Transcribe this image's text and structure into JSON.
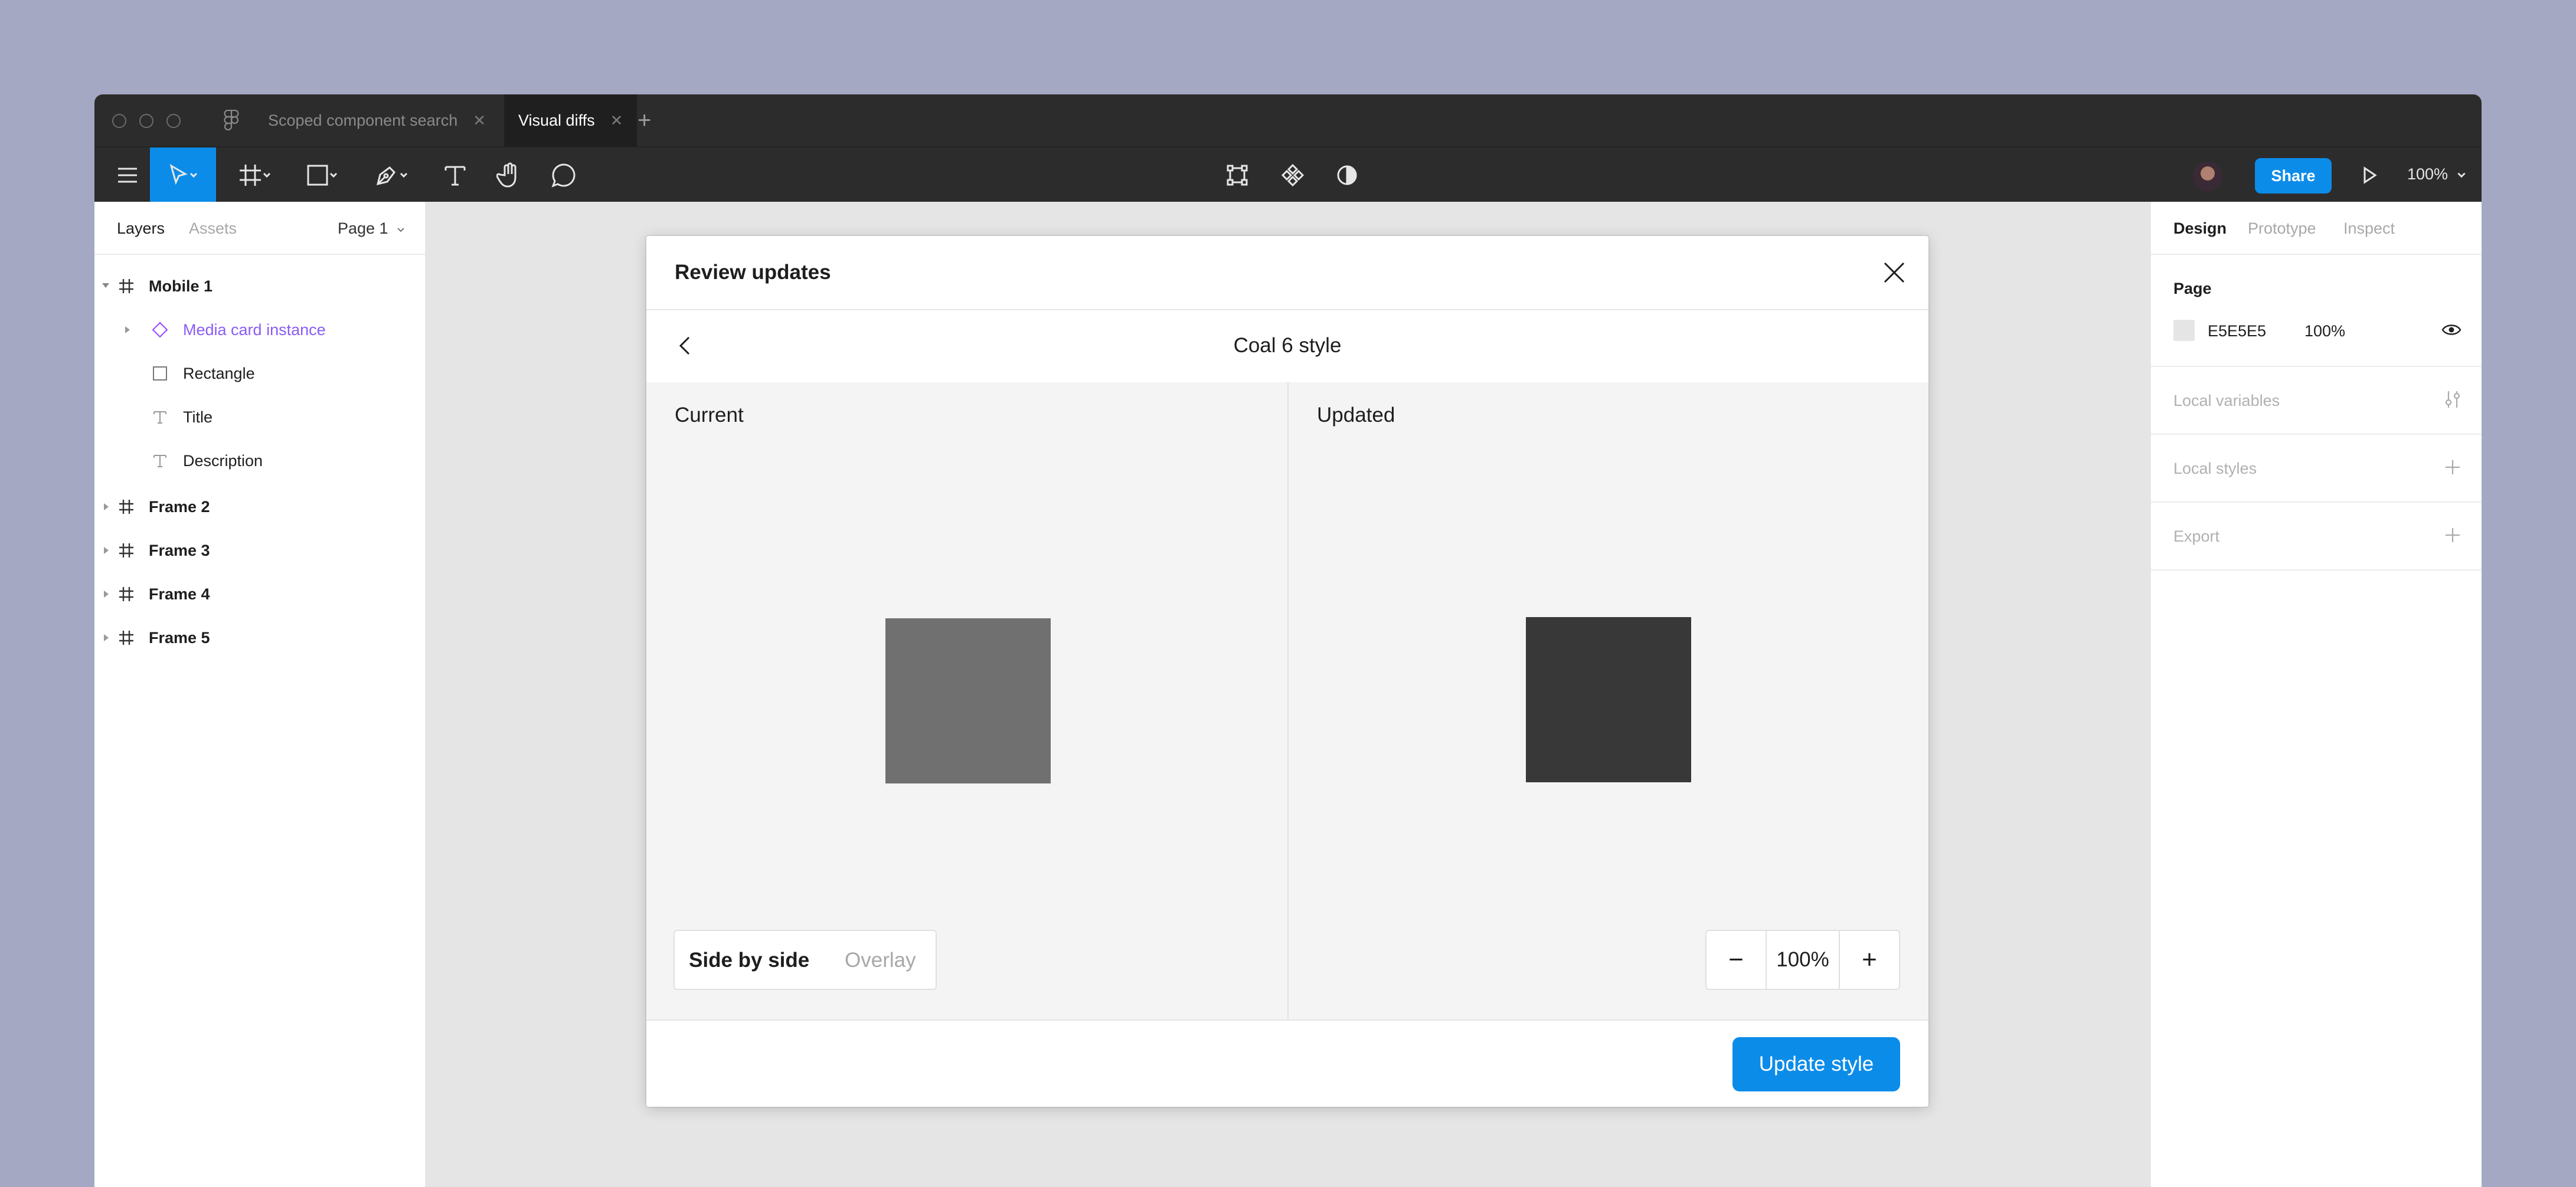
{
  "tabs": [
    {
      "label": "Scoped component search",
      "close": "✕"
    },
    {
      "label": "Visual diffs",
      "close": "✕"
    }
  ],
  "toolbar": {
    "share_label": "Share",
    "zoom": "100%"
  },
  "left_panel": {
    "tabs": [
      "Layers",
      "Assets"
    ],
    "page_selector": "Page 1",
    "layers": [
      {
        "label": "Mobile 1",
        "icon": "frame-icon"
      },
      {
        "label": "Media card instance",
        "icon": "instance-icon"
      },
      {
        "label": "Rectangle",
        "icon": "rectangle-icon"
      },
      {
        "label": "Title",
        "icon": "text-icon"
      },
      {
        "label": "Description",
        "icon": "text-icon"
      },
      {
        "label": "Frame 2",
        "icon": "frame-icon"
      },
      {
        "label": "Frame 3",
        "icon": "frame-icon"
      },
      {
        "label": "Frame 4",
        "icon": "frame-icon"
      },
      {
        "label": "Frame 5",
        "icon": "frame-icon"
      }
    ]
  },
  "right_panel": {
    "tabs": [
      "Design",
      "Prototype",
      "Inspect"
    ],
    "page_section": {
      "title": "Page",
      "color_hex": "E5E5E5",
      "opacity": "100%"
    },
    "sections": [
      "Local variables",
      "Local styles",
      "Export"
    ]
  },
  "modal": {
    "title": "Review updates",
    "style_name": "Coal 6 style",
    "current_label": "Current",
    "updated_label": "Updated",
    "view_modes": [
      "Side by side",
      "Overlay"
    ],
    "zoom": "100%",
    "zoom_out": "−",
    "zoom_in": "+",
    "update_button": "Update style"
  },
  "colors": {
    "accent": "#0c8ce9",
    "current_swatch": "#707070",
    "updated_swatch": "#383838",
    "instance_purple": "#9747ff"
  }
}
